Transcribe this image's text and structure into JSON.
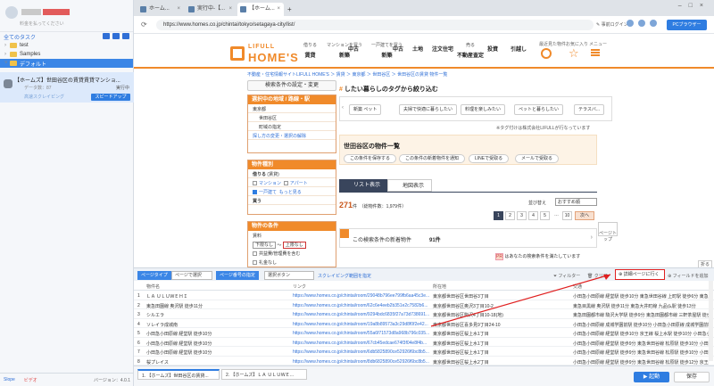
{
  "left_panel": {
    "user_caption": "料金を払ってください",
    "all_tasks": "全てのタスク",
    "folders": [
      {
        "label": "test"
      },
      {
        "label": "Samples"
      },
      {
        "label": "デフォルト"
      }
    ],
    "task": {
      "title": "【ホームズ】世田谷区の賃貸賃貸マンショ...",
      "meta": "データ数：87",
      "state": "実行中",
      "mode": "高速スクレイピング",
      "speedup": "スピードアップ"
    },
    "footer": {
      "status": "Slope",
      "video": "ビデオ",
      "version": "バージョン：4.0.1"
    }
  },
  "browser": {
    "tabs": [
      {
        "label": "ホーム..."
      },
      {
        "label": "実行中-【..."
      },
      {
        "label": "【ホーム..."
      }
    ],
    "url": "https://www.homes.co.jp/chintai/tokyo/setagaya-city/list/",
    "options": "事前ログイン",
    "pc_browser": "PCブラウザー"
  },
  "site": {
    "logo_top": "LIFULL",
    "logo_main": "HOME'S",
    "nav": [
      {
        "top": "借りる",
        "label": "賃貸"
      },
      {
        "top": "マンションを買う",
        "label": "新築"
      },
      {
        "top": "",
        "label": "中古"
      },
      {
        "top": "一戸建てを買う",
        "label": "新築"
      },
      {
        "top": "",
        "label": "中古"
      },
      {
        "top": "",
        "label": "土地"
      },
      {
        "top": "",
        "label": "注文住宅"
      },
      {
        "top": "売る",
        "label": "不動産査定"
      },
      {
        "top": "",
        "label": "投資"
      },
      {
        "top": "",
        "label": "引越し"
      }
    ],
    "nav_recent": "最近見た物件",
    "nav_fav": "お気に入り",
    "nav_menu": "メニュー",
    "breadcrumb": "不動産・住宅情報サイトLIFULL HOME'S ＞ 賃貸 ＞ 東京都 ＞ 世田谷区 ＞ 世田谷区の賃貸 物件一覧",
    "search_change": "検索条件の設定・変更",
    "area_box": {
      "title": "選択中の地域 / 路線・駅",
      "rows": [
        "東京都",
        "世田谷区",
        "町域の指定"
      ],
      "link": "探し方の変更・選択の解除"
    },
    "type_box": {
      "title": "物件種別",
      "rent": "借りる",
      "rent_note": "(賃貸)",
      "mansion": "マンション",
      "apart": "アパート",
      "house": "一戸建て",
      "more": "もっと見る",
      "buy": "買う"
    },
    "cond_box": {
      "title": "物件の条件",
      "rent_label": "賃料",
      "min": "下限なし",
      "max": "上限なし",
      "opt1": "共益費/管理費を含む",
      "opt2": "礼金なし"
    },
    "tag_title": "したい暮らしのタグから絞り込む",
    "tags": [
      "新築 ペット",
      "夫婦で快適に暮らしたい",
      "料理を楽しみたい",
      "ペットと暮らしたい",
      "テラスバ..."
    ],
    "tag_note": "※タグ付けは株式会社LIFULLが行なっています",
    "list_title": "世田谷区の物件一覧",
    "pills": [
      "この条件を保存する",
      "この条件の新着物件を通知",
      "LINEで受取る",
      "メールで受取る"
    ],
    "view_list": "リスト表示",
    "view_map": "地図表示",
    "count": "271",
    "count_unit": "件",
    "count_total": "（総物件数：1,979件）",
    "sort_label": "並び替え",
    "sort_value": "おすすめ順",
    "pages": [
      "2",
      "3",
      "4",
      "5",
      "…",
      "10"
    ],
    "page_current": "1",
    "next": "次へ",
    "new_title": "この検索条件の新着物件",
    "new_count": "91件",
    "cond_text": "はあなたの検索条件を満たしています",
    "cond_tag": "PR",
    "back_top": "ページトップ",
    "fold": "折る"
  },
  "toolbar": {
    "page_type": "ページタイプ",
    "page_type_value": "ページで選択",
    "page_num": "ページ番号の指定",
    "page_num_value": "選択ボタン",
    "scroll_range": "スクレイピング範囲を指定",
    "filter": "フィルター",
    "delete": "クリア",
    "detail": "詳細ページに行く",
    "add_field": "フィールドを追加"
  },
  "table": {
    "headers": [
      "",
      "物件名",
      "リンク",
      "所在地",
      "交通"
    ],
    "rows": [
      {
        "no": "1",
        "name": "ＬＡ ＵＬＵＷＥＨＩ",
        "link": "https://www.homes.co.jp/chintai/room/29048b796ee799fb6aa45c3e...",
        "addr": "東京都世田谷区世田谷3丁目",
        "access": "小田急小田原線 経堂駅 徒歩10分 東急世田谷線 上町駅 徒歩6分 東急田園都市線 二子玉川..."
      },
      {
        "no": "2",
        "name": "東急田園線 奥沢駅 徒歩11分",
        "link": "https://www.homes.co.jp/chintai/room/62c6e4eeb2b351e2c7582b6...",
        "addr": "東京都世田谷区奥沢3丁目10-2",
        "access": "東急目黒線 奥沢駅 徒歩11分 東急大井町線 九品仏駅 徒歩13分"
      },
      {
        "no": "3",
        "name": "シルエラ",
        "link": "https://www.homes.co.jp/chintai/room/9294bdc6835f27a73d738691...",
        "addr": "東京都世田谷区駒沢4丁目10-18(地)",
        "access": "東急田園都市線 駒沢大学駅 徒歩9分 東急田園都市線 三軒茶屋駅 徒歩..."
      },
      {
        "no": "4",
        "name": "ソレイラ成城南",
        "link": "https://www.homes.co.jp/chintai/room/19a8b89573a3c29d8f0f2e42...",
        "addr": "東京都世田谷区喜多見9丁目24-10",
        "access": "小田急小田原線 成城学園前駅 徒歩10分 小田急小田原線 成城学園前駅..."
      },
      {
        "no": "5",
        "name": "小田急小田原線 経堂駅 徒歩10分",
        "link": "https://www.homes.co.jp/chintai/room/55a6f71573d8a968b796c035...",
        "addr": "東京都世田谷区桜上水1丁目",
        "access": "小田急小田原線 経堂駅 徒歩10分 京王線 桜上水駅 徒歩10分 小田急小田原線 千..."
      },
      {
        "no": "6",
        "name": "小田急小田原線 経堂駅 徒歩10分",
        "link": "https://www.homes.co.jp/chintai/room/67cb45edcae674f3f04e8f4b...",
        "addr": "東京都世田谷区桜上水1丁目",
        "access": "小田急小田原線 経堂駅 徒歩9分 東急世田谷線 松原駅 徒歩10分 小田急小田..."
      },
      {
        "no": "7",
        "name": "小田急小田原線 経堂駅 徒歩10分",
        "link": "https://www.homes.co.jp/chintai/room/6db5825890ce52926f6bc8b5...",
        "addr": "東京都世田谷区桜上水1丁目",
        "access": "小田急小田原線 経堂駅 徒歩9分 東急世田谷線 松原駅 徒歩10分 小田急小田..."
      },
      {
        "no": "8",
        "name": "桜プレイス",
        "link": "https://www.homes.co.jp/chintai/room/8db6825890ce52926f6bc8b5...",
        "addr": "東京都世田谷区桜上水2丁目",
        "access": "小田急小田原線 経堂駅 徒歩9分 東急世田谷線 松原駅 徒歩12分 京王線 桜..."
      }
    ]
  },
  "footer": {
    "tabs": [
      "1. 【ホームズ】世田谷区の賃貸...",
      "2. 【ホームズ】ＬＡ ＵＬＵＷＥ..."
    ],
    "start": "起動",
    "save": "保存"
  },
  "colors": {
    "accent": "#f08a2a",
    "primary": "#2f7de1",
    "highlight": "#e02020"
  }
}
